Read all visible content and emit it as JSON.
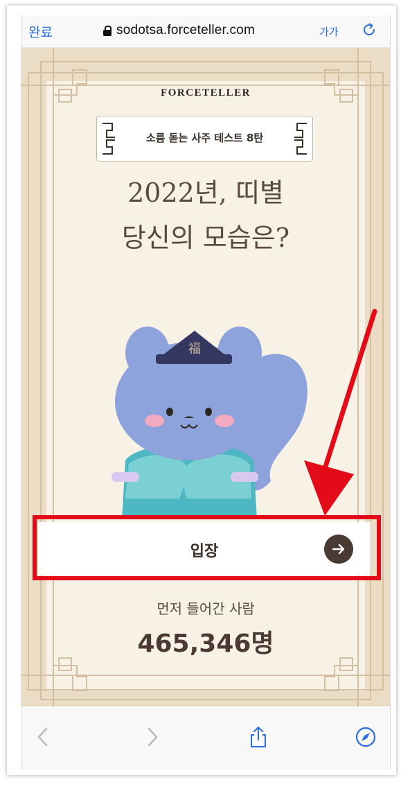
{
  "browser": {
    "done_label": "완료",
    "url": "sodotsa.forceteller.com",
    "text_size_label": "가가"
  },
  "page": {
    "brand": "FORCETELLER",
    "banner": "소름 돋는 사주 테스트 8탄",
    "headline_line1": "2022년, 띠별",
    "headline_line2": "당신의 모습은?",
    "mascot_hat_char": "福",
    "enter_button": "입장",
    "visitors_label": "먼저 들어간 사람",
    "visitors_count": "465,346명"
  },
  "icons": {
    "top": [
      "lock-icon",
      "reload-icon"
    ],
    "bottom": [
      "back-icon",
      "forward-icon",
      "share-icon",
      "compass-icon"
    ],
    "button": "arrow-right-icon"
  },
  "colors": {
    "accent_blue": "#2a6fe0",
    "page_bg": "#f8f1e6",
    "frame_bg": "#ebdcc6",
    "highlight_red": "#e30b17",
    "text_brown": "#4a3a33"
  }
}
